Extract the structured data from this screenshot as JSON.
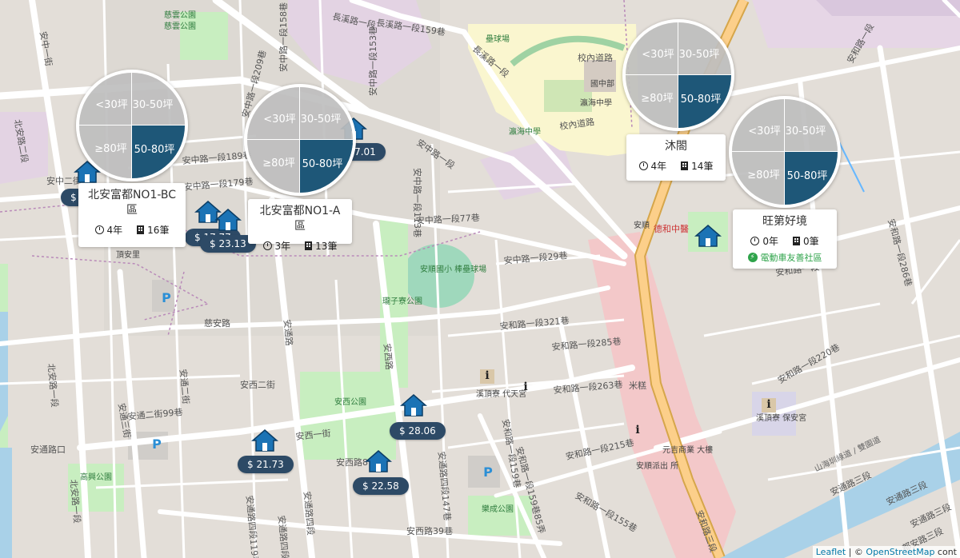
{
  "map_labels": {
    "cigongyuan": "慈雲公園",
    "cigongyuan2": "慈雲公園",
    "changxi_rd_159": "長溪路一段159巷",
    "changxi_rd_1": "長溪路一段",
    "changxi_rd_b": "長溪路一段",
    "an_zhong_1st_st": "安中一街",
    "an_zhong_rd_158": "安中路一段158巷",
    "an_zhong_rd_153": "安中路一段153巷",
    "an_zhong_rd_209": "安中路一段209巷",
    "an_zhong_rd_189": "安中路一段189巷",
    "an_zhong_rd_179": "安中路一段179巷",
    "an_zhong_rd": "安中路一段",
    "an_zhong_rd_113": "安中路一段113巷",
    "an_zhong_rd_77": "安中路一段77巷",
    "an_zhong_rd_29": "安中路一段29巷",
    "an_zhong_2nd_st": "安中二街",
    "beian_rd_2": "北安路二段",
    "beian_rd_1": "北安路一段",
    "beian_rd_1b": "北安路一段",
    "shunan_li": "頂安里",
    "cian_rd": "慈安路",
    "an_tong_rd": "安通路",
    "an_xi_rd": "安西路",
    "an_xi_2nd_st": "安西二街",
    "an_xi_1st_st": "安西一街",
    "an_xi_park": "安西公園",
    "an_tong_2nd_st": "安通二街",
    "an_tong_2nd_99": "安通二街99巷",
    "an_tong_3rd_st": "安通三街",
    "an_tong_road_entrance": "安通路口",
    "gaoxing_park": "高興公園",
    "an_tong_rd_4": "安通路四段",
    "an_tong_rd_4_119": "安通路四段119巷",
    "an_tong_rd_4_147": "安通路四段147巷",
    "an_tong_rd_4_189": "安通路四段189巷",
    "an_xi_rd_8": "安西路8",
    "an_xi_rd_39": "安西路39巷",
    "le_cheng_park": "樂成公園",
    "an_he_rd_321": "安和路一段321巷",
    "an_he_rd_285": "安和路一段285巷",
    "an_he_rd_263": "安和路一段263巷",
    "an_he_rd_215": "安和路一段215巷",
    "an_he_rd_159": "安和路一段159巷",
    "an_he_rd_159_85": "安和路一段159巷85弄",
    "an_he_rd_155": "安和路一段155巷",
    "an_he_rd_a": "安和路一段",
    "an_he_rd_b": "安和路一段",
    "an_he_rd_220": "安和路一段220巷",
    "an_he_rd_286": "安和路一段286巷",
    "anshun_field": "安順國小\n棒壘球場",
    "an_nan_park": "瓏子寮公園",
    "school_inner_rd": "校內道路",
    "school_inner_rd2": "校內道路",
    "school_name": "瀛海中學",
    "middle_school_div": "國中部",
    "school_bus": "瀛海中學",
    "baseball_field": "壘球場",
    "anshun_stop": "安順",
    "dehe_clinic": "德和中醫",
    "hezhi_temple": "溪頂寮\n代天宮",
    "hezhi_temple2": "溪頂寮\n保安宮",
    "yuanquan_market": "元吉商業\n大樓",
    "anshun_office": "安順派出\n所",
    "an_tong_rd_3": "安通路三段",
    "an_tong_rd_3b": "安通路三段",
    "highway": "山海圳綠道 / 雙園道",
    "rice_lane": "米糕",
    "an_he_rd_3": "安和路三段",
    "jinshan_rd": "安通路三段",
    "chen_lane": "都安路三段"
  },
  "price_markers": [
    {
      "label": "$ 17.01"
    },
    {
      "label": "$ 23.13"
    },
    {
      "label": "$ 17.77"
    },
    {
      "label": "$ 28.06"
    },
    {
      "label": "$ 21.73"
    },
    {
      "label": "$ 22.58"
    },
    {
      "label": "$"
    }
  ],
  "pie_quadrants": {
    "tl": "<30坪",
    "tr": "30-50坪",
    "bl": "≥80坪",
    "br": "50-80坪"
  },
  "cards": [
    {
      "title": "北安富都NO1-BC區",
      "years": "4年",
      "count": "16筆"
    },
    {
      "title": "北安富都NO1-A區",
      "years": "3年",
      "count": "13筆"
    },
    {
      "title": "沐閤",
      "years": "4年",
      "count": "14筆"
    },
    {
      "title": "旺第好境",
      "years": "0年",
      "count": "0筆",
      "ev": "電動車友善社區"
    }
  ],
  "attribution": {
    "leaflet": "Leaflet",
    "sep": " | © ",
    "osm": "OpenStreetMap",
    "tail": " cont"
  },
  "colors": {
    "selected_quadrant": "#1e5778",
    "price_pill": "#2d4a66",
    "ev_green": "#2ea34a"
  }
}
